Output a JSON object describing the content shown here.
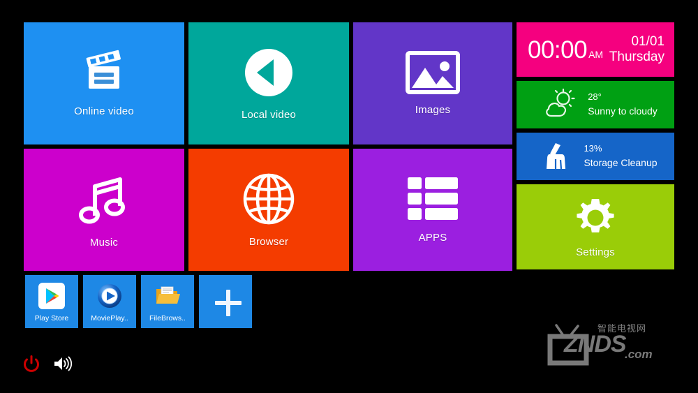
{
  "app": {
    "name": "Android TV Launcher",
    "background": "#000000"
  },
  "tiles": [
    {
      "id": "online-video",
      "label": "Online video",
      "icon": "clapperboard-icon",
      "color": "#1E90F2"
    },
    {
      "id": "local-video",
      "label": "Local video",
      "icon": "play-circle-left-icon",
      "color": "#00A79B"
    },
    {
      "id": "images",
      "label": "Images",
      "icon": "picture-icon",
      "color": "#6236C8"
    },
    {
      "id": "music",
      "label": "Music",
      "icon": "music-note-icon",
      "color": "#CC00CC"
    },
    {
      "id": "browser",
      "label": "Browser",
      "icon": "globe-icon",
      "color": "#F43C00"
    },
    {
      "id": "apps",
      "label": "APPS",
      "icon": "list-grid-icon",
      "color": "#9B1FE0"
    }
  ],
  "clock": {
    "time": "00:00",
    "meridiem": "AM",
    "date": "01/01",
    "weekday": "Thursday",
    "color": "#F5007F"
  },
  "weather": {
    "temperature": "28°",
    "condition": "Sunny to cloudy",
    "icon": "sun-cloud-icon",
    "color": "#00A013"
  },
  "storage": {
    "percent": "13%",
    "label": "Storage Cleanup",
    "icon": "broom-icon",
    "color": "#1565C8"
  },
  "settings": {
    "label": "Settings",
    "icon": "gear-icon",
    "color": "#9ACD08"
  },
  "shortcuts": [
    {
      "id": "play-store",
      "label": "Play Store",
      "icon": "google-play-icon"
    },
    {
      "id": "movieplayer",
      "label": "MoviePlay..",
      "icon": "movie-player-icon"
    },
    {
      "id": "filebrowser",
      "label": "FileBrows..",
      "icon": "folder-icon"
    },
    {
      "id": "add",
      "label": "",
      "icon": "plus-icon"
    }
  ],
  "system": [
    {
      "id": "power",
      "icon": "power-icon",
      "color": "#CC0000"
    },
    {
      "id": "volume",
      "icon": "volume-icon",
      "color": "#FFFFFF"
    }
  ],
  "watermark": {
    "chinese": "智能电视网",
    "brand": "ZNDS",
    "suffix": ".com",
    "icon": "tv-antenna-icon",
    "color": "#8f8f8f"
  }
}
